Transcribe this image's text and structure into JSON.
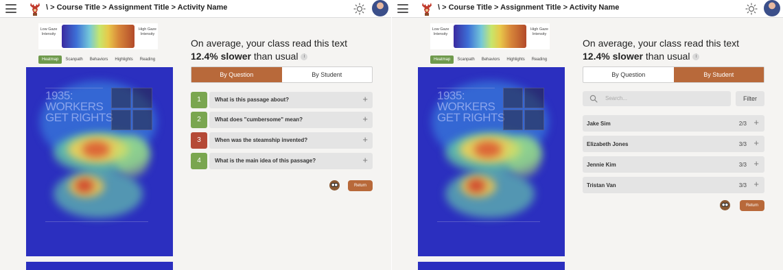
{
  "header": {
    "breadcrumb": "\\ > Course Title > Assignment Title > Activity Name"
  },
  "legend": {
    "low_label": "Low Gaze Intensity",
    "high_label": "High Gaze Intensity"
  },
  "view_tabs": [
    "Heatmap",
    "Scanpath",
    "Behaviors",
    "Highlights",
    "Reading"
  ],
  "active_view_tab": "Heatmap",
  "document": {
    "title_lines": [
      "1935:",
      "WORKERS",
      "GET RIGHTS"
    ]
  },
  "summary": {
    "prefix": "On average, your class read this text ",
    "value": "12.4%",
    "emph_word": "slower",
    "suffix": " than usual"
  },
  "segments": {
    "by_question": "By Question",
    "by_student": "By Student"
  },
  "left_screen": {
    "active_segment": "By Question"
  },
  "right_screen": {
    "active_segment": "By Student"
  },
  "questions": [
    {
      "number": "1",
      "text": "What is this passage about?",
      "color": "#7aa64f"
    },
    {
      "number": "2",
      "text": "What does \"cumbersome\" mean?",
      "color": "#7aa64f"
    },
    {
      "number": "3",
      "text": "When was the steamship invented?",
      "color": "#b54a36"
    },
    {
      "number": "4",
      "text": "What is the main idea of this passage?",
      "color": "#7aa64f"
    }
  ],
  "search": {
    "placeholder": "Search...",
    "filter_label": "Filter"
  },
  "students": [
    {
      "name": "Jake Sim",
      "score": "2/3"
    },
    {
      "name": "Elizabeth Jones",
      "score": "3/3"
    },
    {
      "name": "Jennie Kim",
      "score": "3/3"
    },
    {
      "name": "Tristan Van",
      "score": "3/3"
    }
  ],
  "return_label": "Return",
  "colors": {
    "accent": "#b8693a",
    "correct": "#7aa64f",
    "incorrect": "#b54a36",
    "heat_base": "#2b2fbf"
  },
  "icons": [
    "hamburger-menu-icon",
    "deer-logo-icon",
    "sun-icon",
    "avatar",
    "info-icon",
    "plus-icon",
    "search-icon",
    "owl-mascot-icon"
  ]
}
